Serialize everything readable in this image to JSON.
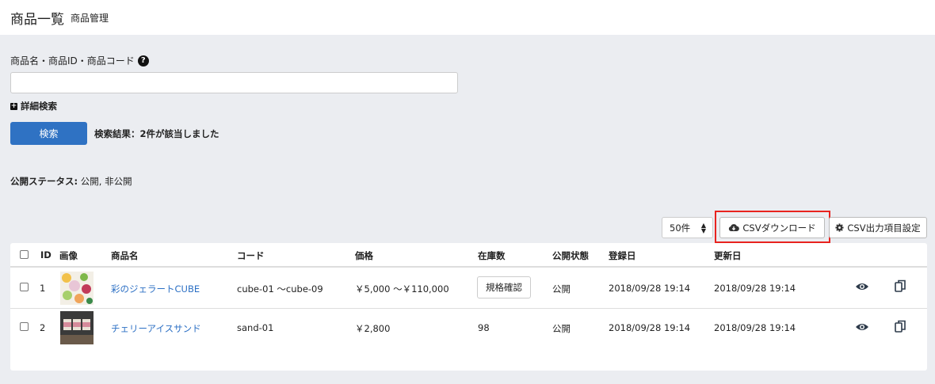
{
  "header": {
    "title": "商品一覧",
    "subtitle": "商品管理"
  },
  "search": {
    "label": "商品名・商品ID・商品コード",
    "value": "",
    "placeholder": "",
    "advanced_label": "詳細検索",
    "button_label": "検索",
    "result_text": "検索結果：2件が該当しました"
  },
  "filter": {
    "status_label": "公開ステータス:",
    "status_value": "公開, 非公開"
  },
  "toolbar": {
    "per_page": "50件",
    "csv_download": "CSVダウンロード",
    "csv_settings": "CSV出力項目設定"
  },
  "table": {
    "columns": [
      "ID",
      "画像",
      "商品名",
      "コード",
      "価格",
      "在庫数",
      "公開状態",
      "登録日",
      "更新日"
    ],
    "rows": [
      {
        "id": "1",
        "name": "彩のジェラートCUBE",
        "code": "cube-01 ～cube-09",
        "price": "￥5,000 ～￥110,000",
        "stock": "規格確認",
        "status": "公開",
        "created": "2018/09/28 19:14",
        "updated": "2018/09/28 19:14"
      },
      {
        "id": "2",
        "name": "チェリーアイスサンド",
        "code": "sand-01",
        "price": "￥2,800",
        "stock": "98",
        "status": "公開",
        "created": "2018/09/28 19:14",
        "updated": "2018/09/28 19:14"
      }
    ]
  },
  "colors": {
    "primary": "#2f72c3",
    "link": "#2b6fc4",
    "highlight": "#e8231f",
    "background": "#ebedf1"
  },
  "icons": [
    "help-icon",
    "plus-square-icon",
    "cloud-download-icon",
    "gear-icon",
    "eye-icon",
    "copy-icon",
    "sort-arrows-icon"
  ]
}
